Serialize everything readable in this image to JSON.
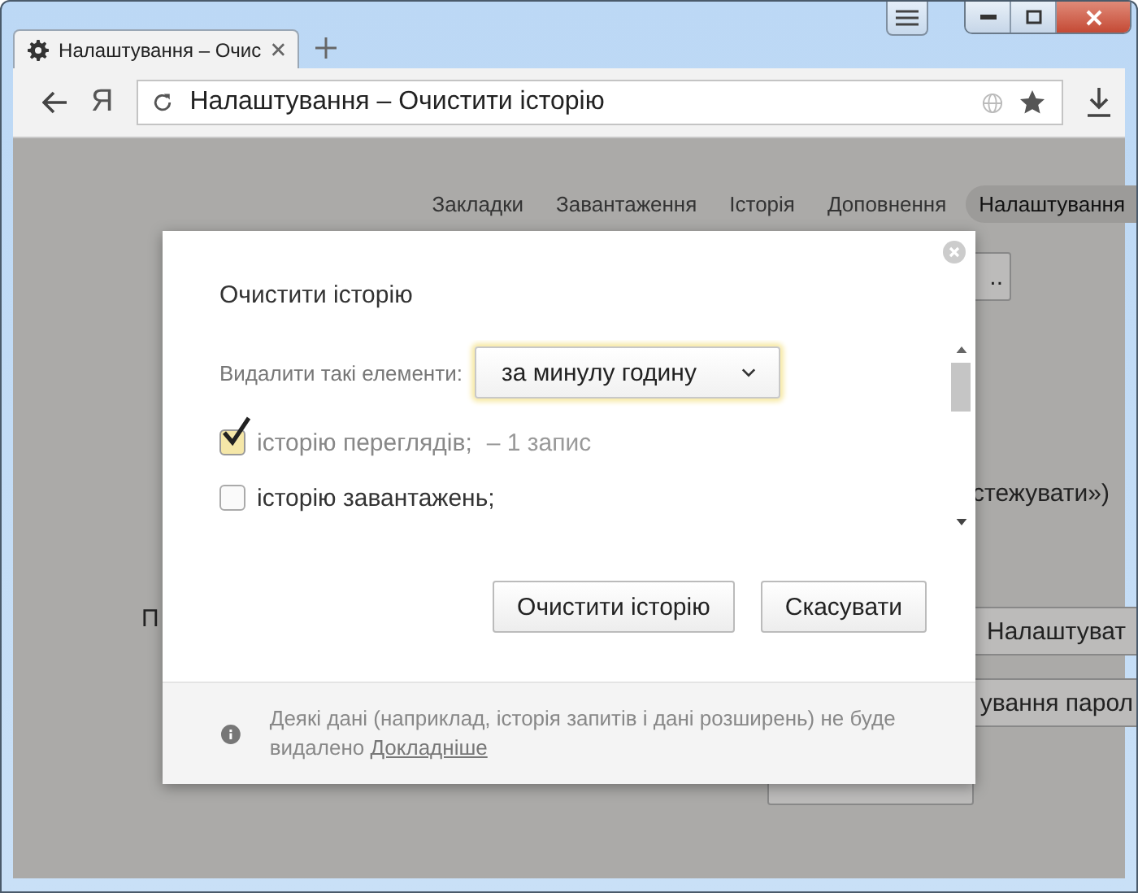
{
  "tab": {
    "title": "Налаштування – Очис"
  },
  "toolbar": {
    "logo": "Я",
    "address": "Налаштування – Очистити історію"
  },
  "settings_nav": [
    {
      "label": "Закладки",
      "selected": false
    },
    {
      "label": "Завантаження",
      "selected": false
    },
    {
      "label": "Історія",
      "selected": false
    },
    {
      "label": "Доповнення",
      "selected": false
    },
    {
      "label": "Налаштування",
      "selected": true
    }
  ],
  "background": {
    "more_button": "..",
    "privacy_text": "стежувати»)",
    "section_label": "П",
    "settings_button": "Налаштуват",
    "passwords_button": "ування парол"
  },
  "dialog": {
    "title": "Очистити історію",
    "delete_label": "Видалити такі елементи:",
    "period": "за минулу годину",
    "items": [
      {
        "label": "історію переглядів;",
        "count": "– 1 запис",
        "checked": true
      },
      {
        "label": "історію завантажень;",
        "checked": false
      }
    ],
    "buttons": [
      "Очистити історію",
      "Скасувати"
    ],
    "note": "Деякі дані (наприклад, історія запитів і дані розширень) не буде видалено",
    "note_link": "Докладніше"
  }
}
